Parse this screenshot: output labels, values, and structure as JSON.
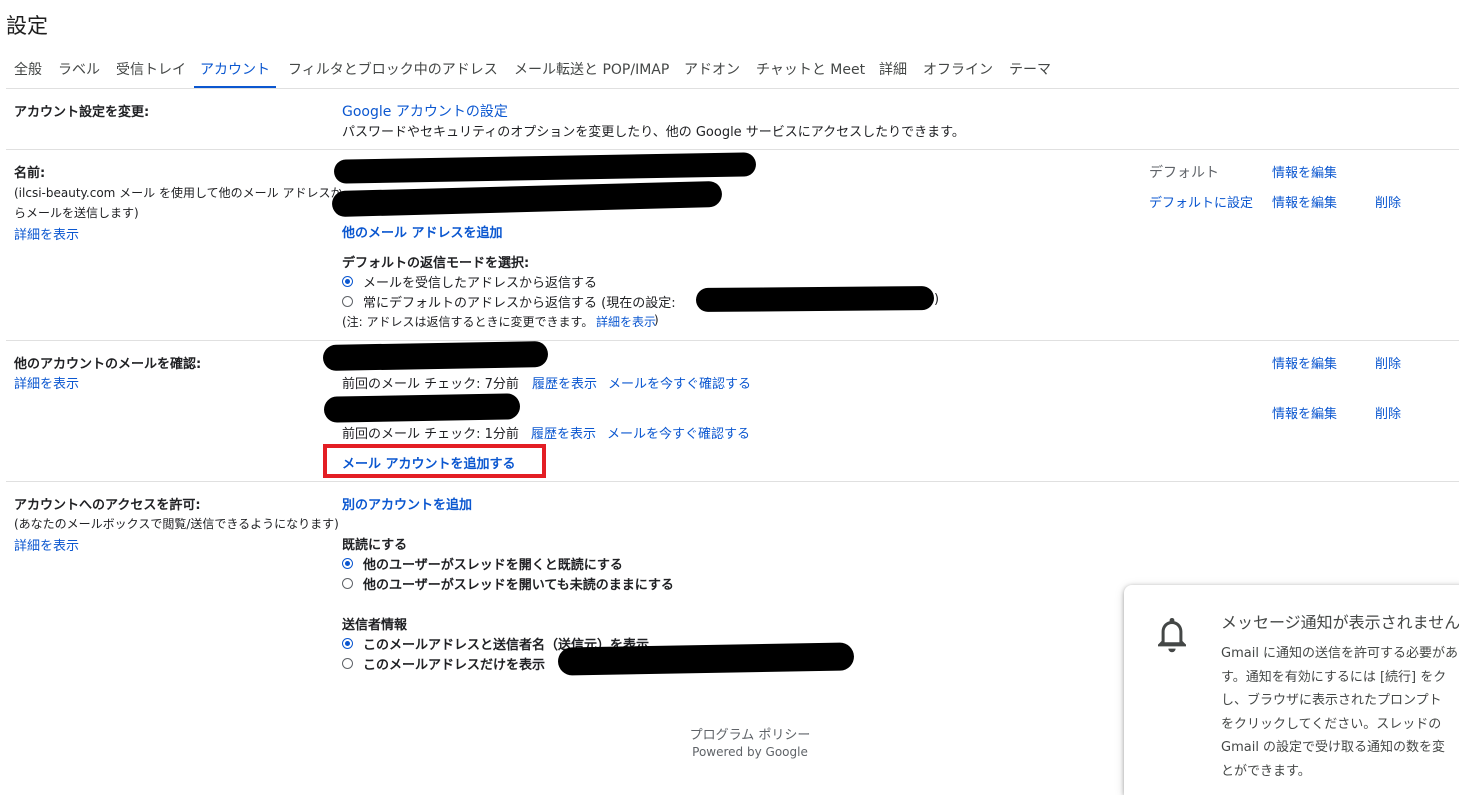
{
  "page": {
    "title": "設定"
  },
  "tabs": [
    {
      "label": "全般"
    },
    {
      "label": "ラベル"
    },
    {
      "label": "受信トレイ"
    },
    {
      "label": "アカウント"
    },
    {
      "label": "フィルタとブロック中のアドレス"
    },
    {
      "label": "メール転送と POP/IMAP"
    },
    {
      "label": "アドオン"
    },
    {
      "label": "チャットと Meet"
    },
    {
      "label": "詳細"
    },
    {
      "label": "オフライン"
    },
    {
      "label": "テーマ"
    }
  ],
  "account_settings": {
    "label": "アカウント設定を変更:",
    "link": "Google アカウントの設定",
    "desc": "パスワードやセキュリティのオプションを変更したり、他の Google サービスにアクセスしたりできます。"
  },
  "name_section": {
    "label": "名前:",
    "desc_line1": "(ilcsi-beauty.com メール を使用して他のメール アドレスか",
    "desc_line2": "らメールを送信します)",
    "details_link": "詳細を表示",
    "row1": {
      "default_text": "デフォルト",
      "edit": "情報を編集"
    },
    "row2": {
      "set_default": "デフォルトに設定",
      "edit": "情報を編集",
      "delete": "削除"
    },
    "add_address": "他のメール アドレスを追加",
    "reply_mode_label": "デフォルトの返信モードを選択:",
    "reply_option1": "メールを受信したアドレスから返信する",
    "reply_option2_prefix": "常にデフォルトのアドレスから返信する (現在の設定:",
    "reply_option2_suffix": ")",
    "note_prefix": "(注: アドレスは返信するときに変更できます。",
    "note_link": "詳細を表示",
    "note_suffix": ")"
  },
  "check_mail": {
    "label": "他のアカウントのメールを確認:",
    "details_link": "詳細を表示",
    "accounts": [
      {
        "status": "前回のメール チェック: 7分前",
        "history": "履歴を表示",
        "check_now": "メールを今すぐ確認する",
        "edit": "情報を編集",
        "delete": "削除"
      },
      {
        "status": "前回のメール チェック: 1分前",
        "history": "履歴を表示",
        "check_now": "メールを今すぐ確認する",
        "edit": "情報を編集",
        "delete": "削除"
      }
    ],
    "add_account": "メール アカウントを追加する"
  },
  "grant_access": {
    "label": "アカウントへのアクセスを許可:",
    "desc": "(あなたのメールボックスで閲覧/送信できるようになります)",
    "details_link": "詳細を表示",
    "add_another": "別のアカウントを追加",
    "read_label": "既読にする",
    "read_option1": "他のユーザーがスレッドを開くと既読にする",
    "read_option2": "他のユーザーがスレッドを開いても未読のままにする",
    "sender_label": "送信者情報",
    "sender_option1": "このメールアドレスと送信者名（送信元）を表示",
    "sender_option2": "このメールアドレスだけを表示"
  },
  "footer": {
    "policy": "プログラム ポリシー",
    "powered": "Powered by Google"
  },
  "notification": {
    "icon": "bell-icon",
    "title": "メッセージ通知が表示されません",
    "body_lines": [
      "Gmail に通知の送信を許可する必要があ",
      "す。通知を有効にするには [続行] をク",
      "し、ブラウザに表示されたプロンプト",
      "をクリックしてください。スレッドの",
      "Gmail の設定で受け取る通知の数を変",
      "とができます。"
    ]
  },
  "colors": {
    "link": "#0b57d0",
    "highlight_box": "#e31e24",
    "divider": "#e0e0e0"
  }
}
